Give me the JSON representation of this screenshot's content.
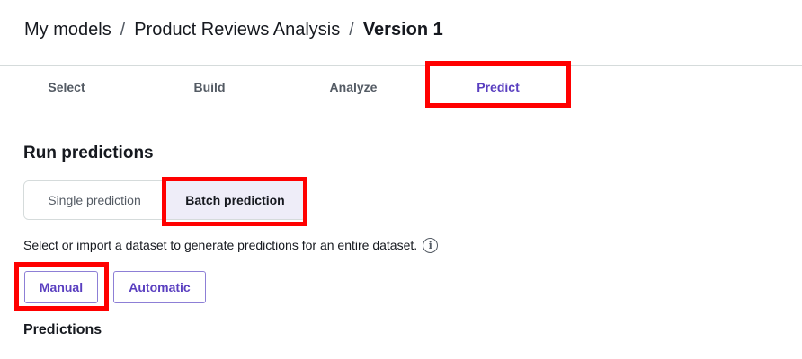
{
  "breadcrumb": {
    "items": [
      "My models",
      "Product Reviews Analysis"
    ],
    "separator": "/",
    "current": "Version 1"
  },
  "tabs": [
    {
      "label": "Select",
      "active": false
    },
    {
      "label": "Build",
      "active": false
    },
    {
      "label": "Analyze",
      "active": false
    },
    {
      "label": "Predict",
      "active": true
    }
  ],
  "main": {
    "section_title": "Run predictions",
    "prediction_mode": {
      "options": [
        "Single prediction",
        "Batch prediction"
      ],
      "selected": "Batch prediction"
    },
    "description": "Select or import a dataset to generate predictions for an entire dataset.",
    "info_icon": "i",
    "buttons": {
      "manual": "Manual",
      "automatic": "Automatic"
    },
    "predictions_title": "Predictions"
  },
  "colors": {
    "accent": "#5a3fc0",
    "highlight": "#ff0000",
    "selected_segment_bg": "#eeedf8"
  },
  "icons": {
    "info": "info-circle-icon"
  }
}
